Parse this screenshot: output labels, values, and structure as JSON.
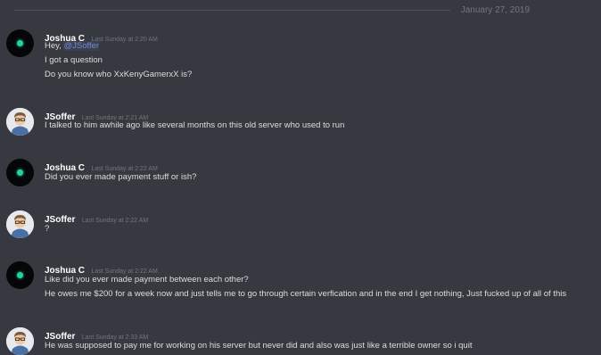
{
  "date_divider": "January 27, 2019",
  "messages": [
    {
      "author": "Joshua C",
      "timestamp": "Last Sunday at 2:20 AM",
      "lines": [
        "Hey, ",
        "I got a question",
        "Do you know who XxKenyGamerxX is?"
      ],
      "mention": "@JSoffer"
    },
    {
      "author": "JSoffer",
      "timestamp": "Last Sunday at 2:21 AM",
      "lines": [
        "I talked to him awhile ago like several months on this old server who used to run"
      ]
    },
    {
      "author": "Joshua C",
      "timestamp": "Last Sunday at 2:22 AM",
      "lines": [
        "Did you ever made payment stuff or ish?"
      ]
    },
    {
      "author": "JSoffer",
      "timestamp": "Last Sunday at 2:22 AM",
      "lines": [
        "?"
      ]
    },
    {
      "author": "Joshua C",
      "timestamp": "Last Sunday at 2:22 AM",
      "lines": [
        "Like did you ever made payment between each other?",
        "He owes me $200 for a week now and just tells me to go through certain verfication and in the end I get nothing, Just fucked up of all of this"
      ]
    },
    {
      "author": "JSoffer",
      "timestamp": "Last Sunday at 2:33 AM",
      "lines": [
        "He was supposed to pay me for working on his server but never did and also was just like a terrible owner so i quit"
      ]
    }
  ]
}
